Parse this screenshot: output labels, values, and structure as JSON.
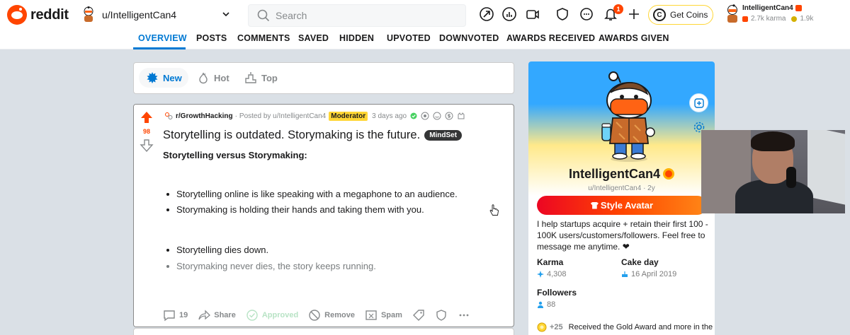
{
  "header": {
    "brand": "reddit",
    "user_dropdown_name": "u/IntelligentCan4",
    "search_placeholder": "Search",
    "notification_count": "1",
    "get_coins_label": "Get Coins",
    "account_name": "IntelligentCan4",
    "account_karma": "2.7k karma",
    "account_coins": "1.9k"
  },
  "tabs": [
    {
      "label": "OVERVIEW",
      "active": true
    },
    {
      "label": "POSTS"
    },
    {
      "label": "COMMENTS"
    },
    {
      "label": "SAVED"
    },
    {
      "label": "HIDDEN"
    },
    {
      "label": "UPVOTED"
    },
    {
      "label": "DOWNVOTED"
    },
    {
      "label": "AWARDS RECEIVED"
    },
    {
      "label": "AWARDS GIVEN"
    }
  ],
  "sort": {
    "new": "New",
    "hot": "Hot",
    "top": "Top"
  },
  "post": {
    "votes": "98",
    "subreddit": "r/GrowthHacking",
    "posted_by": "Posted by u/IntelligentCan4",
    "moderator_badge": "Moderator",
    "time": "3 days ago",
    "title": "Storytelling is outdated. Storymaking is the future.",
    "flair": "MindSet",
    "subtitle": "Storytelling versus Storymaking:",
    "bullets": [
      "Storytelling online is like speaking with a megaphone to an audience.",
      "Storymaking is holding their hands and taking them with you.",
      "Storytelling dies down.",
      "Storymaking never dies, the story keeps running."
    ],
    "actions": {
      "comments": "19",
      "share": "Share",
      "approved": "Approved",
      "remove": "Remove",
      "spam": "Spam"
    }
  },
  "profile": {
    "name": "IntelligentCan4",
    "handle": "u/IntelligentCan4 · 2y",
    "style_avatar": "Style Avatar",
    "bio": "I help startups acquire + retain their first 100 - 100K users/customers/followers. Feel free to message me anytime. ❤",
    "karma_label": "Karma",
    "karma_value": "4,308",
    "cake_label": "Cake day",
    "cake_value": "16 April 2019",
    "followers_label": "Followers",
    "followers_value": "88",
    "award_count": "+25",
    "award_text": "Received the Gold Award and more in the"
  },
  "colors": {
    "brand": "#ff4500",
    "accent": "#0079d3",
    "moderator": "#ffd635",
    "approved": "#46d160"
  }
}
